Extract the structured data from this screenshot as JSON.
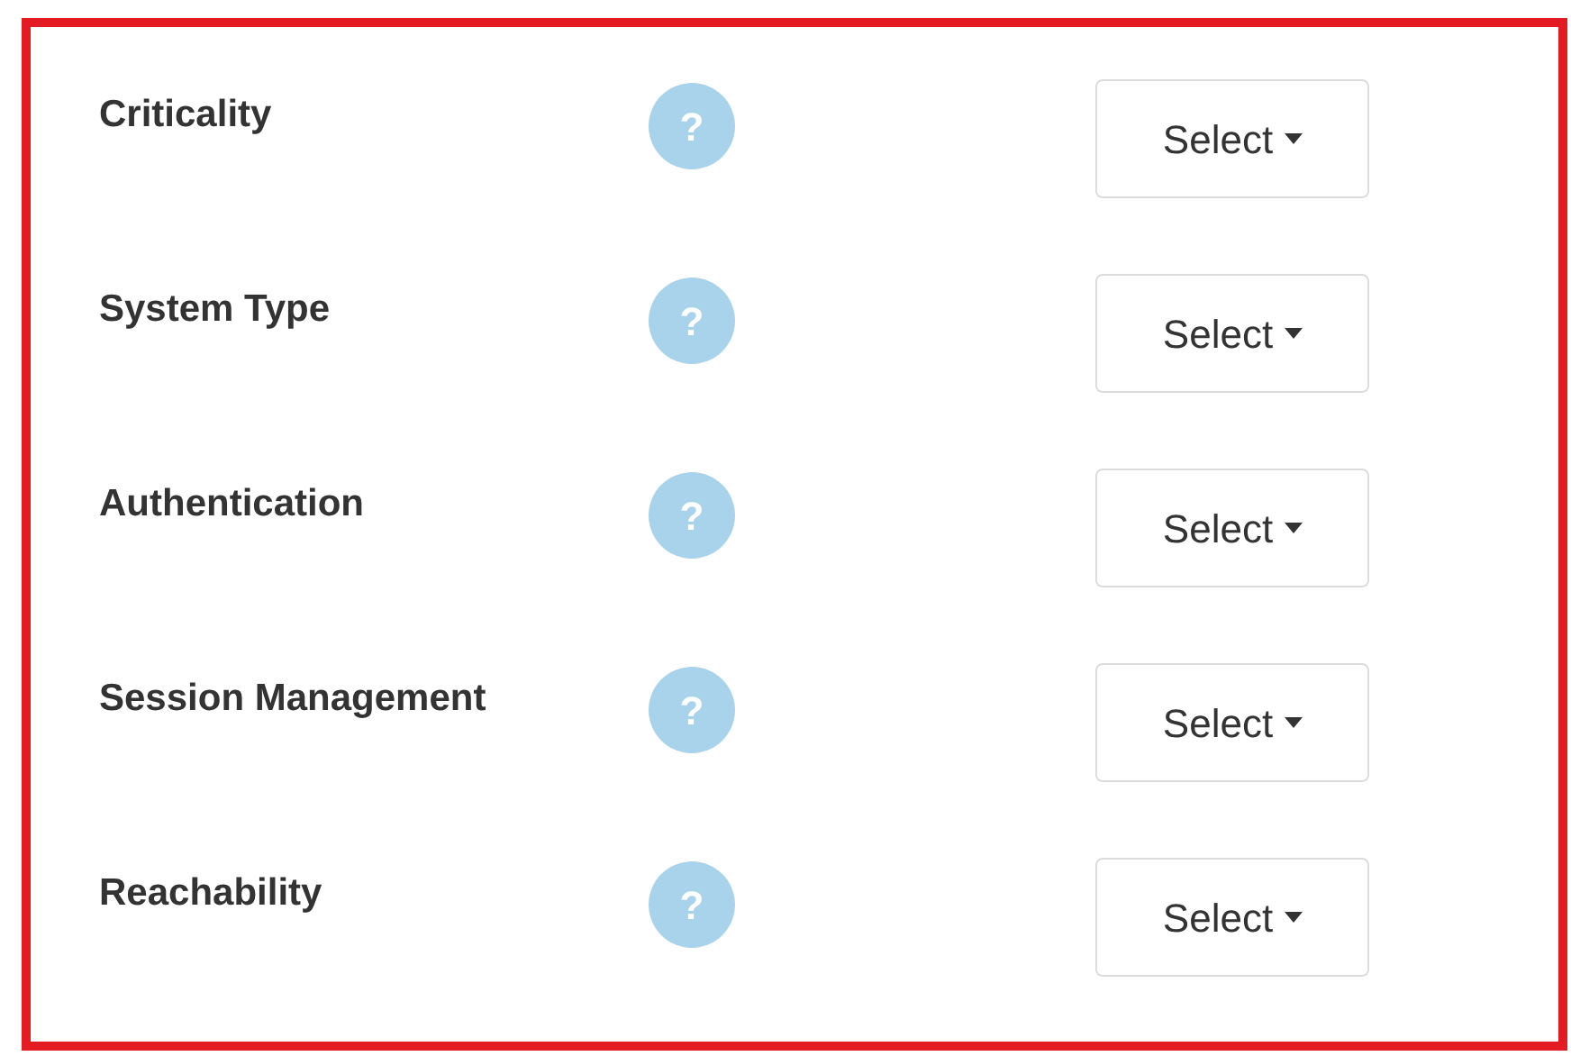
{
  "rows": [
    {
      "label": "Criticality",
      "help": "?",
      "select": "Select"
    },
    {
      "label": "System Type",
      "help": "?",
      "select": "Select"
    },
    {
      "label": "Authentication",
      "help": "?",
      "select": "Select"
    },
    {
      "label": "Session Management",
      "help": "?",
      "select": "Select"
    },
    {
      "label": "Reachability",
      "help": "?",
      "select": "Select"
    }
  ]
}
